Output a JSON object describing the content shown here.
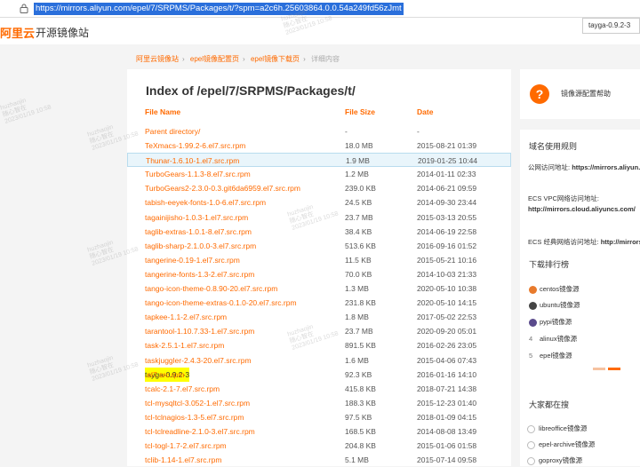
{
  "browser": {
    "url": "https://mirrors.aliyun.com/epel/7/SRPMS/Packages/t/?spm=a2c6h.25603864.0.0.54a249fd56zJmt",
    "find_query": "tayga-0.9.2-3"
  },
  "header": {
    "logo": "阿里云",
    "site_title": "开源镜像站"
  },
  "breadcrumb": [
    "阿里云镜像站",
    "epel镜像配置页",
    "epel镜像下载页",
    "详细内容"
  ],
  "listing": {
    "title": "Index of /epel/7/SRPMS/Packages/t/",
    "columns": {
      "name": "File Name",
      "size": "File Size",
      "date": "Date"
    },
    "files": [
      {
        "name": "Parent directory/",
        "size": "-",
        "date": "-"
      },
      {
        "name": "TeXmacs-1.99.2-6.el7.src.rpm",
        "size": "18.0 MB",
        "date": "2015-08-21 01:39"
      },
      {
        "name": "Thunar-1.6.10-1.el7.src.rpm",
        "size": "1.9 MB",
        "date": "2019-01-25 10:44"
      },
      {
        "name": "TurboGears-1.1.3-8.el7.src.rpm",
        "size": "1.2 MB",
        "date": "2014-01-11 02:33"
      },
      {
        "name": "TurboGears2-2.3.0-0.3.git6da6959.el7.src.rpm",
        "size": "239.0 KB",
        "date": "2014-06-21 09:59"
      },
      {
        "name": "tabish-eeyek-fonts-1.0-6.el7.src.rpm",
        "size": "24.5 KB",
        "date": "2014-09-30 23:44"
      },
      {
        "name": "tagainijisho-1.0.3-1.el7.src.rpm",
        "size": "23.7 MB",
        "date": "2015-03-13 20:55"
      },
      {
        "name": "taglib-extras-1.0.1-8.el7.src.rpm",
        "size": "38.4 KB",
        "date": "2014-06-19 22:58"
      },
      {
        "name": "taglib-sharp-2.1.0.0-3.el7.src.rpm",
        "size": "513.6 KB",
        "date": "2016-09-16 01:52"
      },
      {
        "name": "tangerine-0.19-1.el7.src.rpm",
        "size": "11.5 KB",
        "date": "2015-05-21 10:16"
      },
      {
        "name": "tangerine-fonts-1.3-2.el7.src.rpm",
        "size": "70.0 KB",
        "date": "2014-10-03 21:33"
      },
      {
        "name": "tango-icon-theme-0.8.90-20.el7.src.rpm",
        "size": "1.3 MB",
        "date": "2020-05-10 10:38"
      },
      {
        "name": "tango-icon-theme-extras-0.1.0-20.el7.src.rpm",
        "size": "231.8 KB",
        "date": "2020-05-10 14:15"
      },
      {
        "name": "tapkee-1.1-2.el7.src.rpm",
        "size": "1.8 MB",
        "date": "2017-05-02 22:53"
      },
      {
        "name": "tarantool-1.10.7.33-1.el7.src.rpm",
        "size": "23.7 MB",
        "date": "2020-09-20 05:01"
      },
      {
        "name": "task-2.5.1-1.el7.src.rpm",
        "size": "891.5 KB",
        "date": "2016-02-26 23:05"
      },
      {
        "name": "taskjuggler-2.4.3-20.el7.src.rpm",
        "size": "1.6 MB",
        "date": "2015-04-06 07:43"
      },
      {
        "name_mark": "tayga-0.9.2-3",
        "name_rest": ".el7.src.rpm",
        "size": "92.3 KB",
        "date": "2016-01-16 14:10"
      },
      {
        "name": "tcalc-2.1-7.el7.src.rpm",
        "size": "415.8 KB",
        "date": "2018-07-21 14:38"
      },
      {
        "name": "tcl-mysqltcl-3.052-1.el7.src.rpm",
        "size": "188.3 KB",
        "date": "2015-12-23 01:40"
      },
      {
        "name": "tcl-tclnagios-1.3-5.el7.src.rpm",
        "size": "97.5 KB",
        "date": "2018-01-09 04:15"
      },
      {
        "name": "tcl-tclreadline-2.1.0-3.el7.src.rpm",
        "size": "168.5 KB",
        "date": "2014-08-08 13:49"
      },
      {
        "name": "tcl-togl-1.7-2.el7.src.rpm",
        "size": "204.8 KB",
        "date": "2015-01-06 01:58"
      },
      {
        "name": "tclib-1.14-1.el7.src.rpm",
        "size": "5.1 MB",
        "date": "2015-07-14 09:58"
      }
    ]
  },
  "sidebar": {
    "help": "镜像源配置帮助",
    "domain": {
      "title": "域名使用规则",
      "public_label": "公网访问地址:",
      "public_url": "https://mirrors.aliyun.com",
      "vpc_label": "ECS VPC网络访问地址:",
      "vpc_url": "http://mirrors.cloud.aliyuncs.com/",
      "classic_label": "ECS 经典网络访问地址:",
      "classic_url": "http://mirrors.a"
    },
    "ranking": {
      "title": "下载排行榜",
      "items": [
        {
          "rank": "1",
          "label": "centos镜像源",
          "color": "#e87a2c"
        },
        {
          "rank": "2",
          "label": "ubuntu镜像源",
          "color": "#444444"
        },
        {
          "rank": "3",
          "label": "pypi镜像源",
          "color": "#5a4b8c"
        },
        {
          "rank": "4",
          "label": "alinux镜像源"
        },
        {
          "rank": "5",
          "label": "epel镜像源"
        }
      ]
    },
    "searching": {
      "title": "大家都在搜",
      "items": [
        "libreoffice镜像源",
        "epel-archive镜像源",
        "goproxy镜像源"
      ]
    }
  },
  "watermark": {
    "name": "huzhaojin",
    "date": "2023/01/19 10:58",
    "line2": "随心智在"
  },
  "colors": {
    "accent": "#ff6a00",
    "highlight": "#ffff00",
    "selection": "#2a6fdb"
  }
}
